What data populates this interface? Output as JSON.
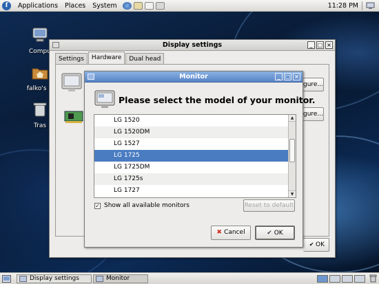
{
  "top_panel": {
    "menus": [
      "Applications",
      "Places",
      "System"
    ],
    "clock": "11:28 PM"
  },
  "desktop_icons": [
    {
      "label": "Compu"
    },
    {
      "label": "falko's H"
    },
    {
      "label": "Tras"
    }
  ],
  "display_settings": {
    "title": "Display settings",
    "tabs": [
      "Settings",
      "Hardware",
      "Dual head"
    ],
    "configure_partial": "gure...",
    "ok_label": "OK"
  },
  "monitor_dialog": {
    "title": "Monitor",
    "heading": "Please select the model of your monitor.",
    "models": [
      "LG 1520",
      "LG 1520DM",
      "LG 1527",
      "LG 1725",
      "LG 1725DM",
      "LG 1725s",
      "LG 1727"
    ],
    "selected_index": 3,
    "show_all_label": "Show all available monitors",
    "show_all_checked": true,
    "reset_label": "Reset to default",
    "cancel_label": "Cancel",
    "ok_label": "OK"
  },
  "taskbar": {
    "tasks": [
      "Display settings",
      "Monitor"
    ]
  }
}
